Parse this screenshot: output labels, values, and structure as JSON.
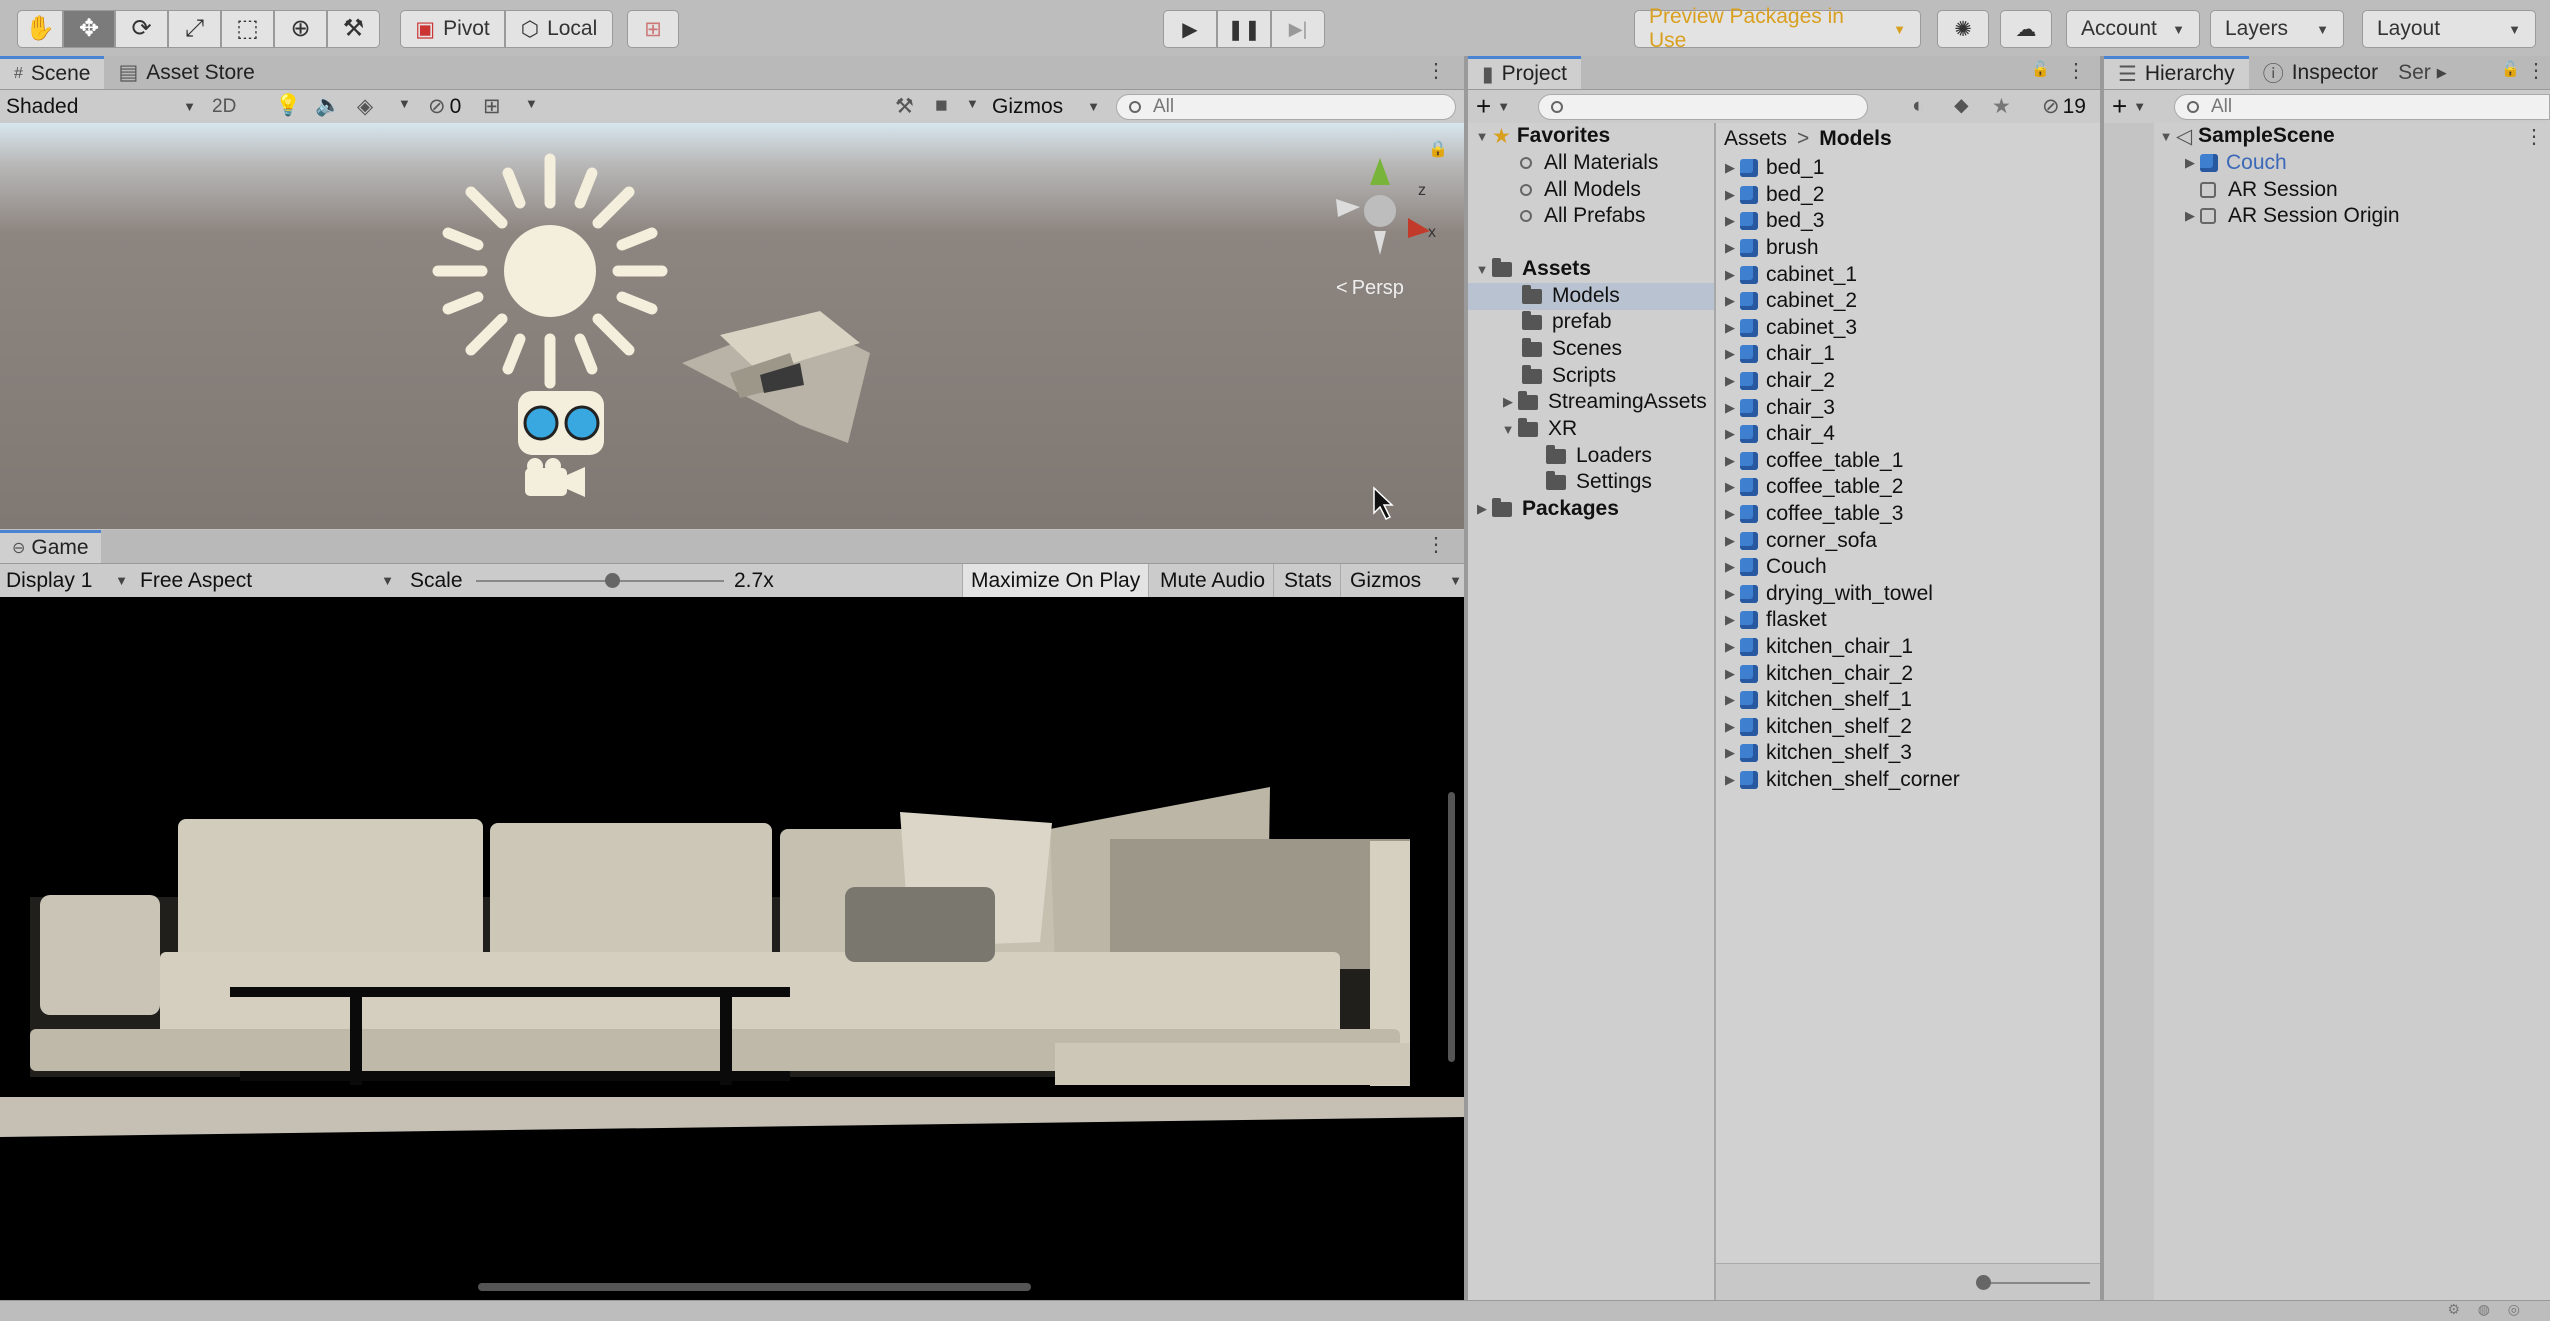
{
  "toolbar": {
    "tools": [
      "hand-tool",
      "move-tool",
      "rotate-tool",
      "scale-tool",
      "rect-tool",
      "transform-tool",
      "custom-tool"
    ],
    "pivot_label": "Pivot",
    "local_label": "Local",
    "preview_packages": "Preview Packages in Use",
    "account_label": "Account",
    "layers_label": "Layers",
    "layout_label": "Layout"
  },
  "scene": {
    "tabs": [
      "Scene",
      "Asset Store"
    ],
    "shading": "Shaded",
    "twod": "2D",
    "hidden_count": "0",
    "gizmos": "Gizmos",
    "search_placeholder": "All",
    "persp": "Persp"
  },
  "game": {
    "tab": "Game",
    "display": "Display 1",
    "aspect": "Free Aspect",
    "scale_label": "Scale",
    "scale_value": "2.7x",
    "scale_fraction": 0.55,
    "maximize": "Maximize On Play",
    "mute": "Mute Audio",
    "stats": "Stats",
    "gizmos": "Gizmos"
  },
  "project": {
    "tab": "Project",
    "hidden_count": "19",
    "favorites": {
      "label": "Favorites",
      "items": [
        "All Materials",
        "All Models",
        "All Prefabs"
      ]
    },
    "assets": {
      "label": "Assets",
      "folders": [
        "Models",
        "prefab",
        "Scenes",
        "Scripts",
        "StreamingAssets",
        "XR",
        "Loaders",
        "Settings"
      ]
    },
    "packages": "Packages",
    "breadcrumb": [
      "Assets",
      "Models"
    ],
    "files": [
      "bed_1",
      "bed_2",
      "bed_3",
      "brush",
      "cabinet_1",
      "cabinet_2",
      "cabinet_3",
      "chair_1",
      "chair_2",
      "chair_3",
      "chair_4",
      "coffee_table_1",
      "coffee_table_2",
      "coffee_table_3",
      "corner_sofa",
      "Couch",
      "drying_with_towel",
      "flasket",
      "kitchen_chair_1",
      "kitchen_chair_2",
      "kitchen_shelf_1",
      "kitchen_shelf_2",
      "kitchen_shelf_3",
      "kitchen_shelf_corner"
    ]
  },
  "hierarchy": {
    "tabs": [
      "Hierarchy",
      "Inspector",
      "Ser"
    ],
    "search_placeholder": "All",
    "scene_name": "SampleScene",
    "items": [
      "Couch",
      "AR Session",
      "AR Session Origin"
    ]
  },
  "colors": {
    "accent": "#4a83d4",
    "preview_text": "#d9a020",
    "selected_item": "#3b68b8"
  }
}
